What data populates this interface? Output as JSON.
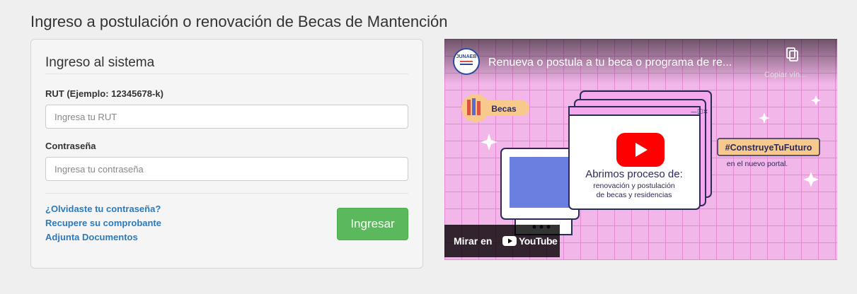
{
  "page": {
    "title": "Ingreso a postulación o renovación de Becas de Mantención"
  },
  "login": {
    "legend": "Ingreso al sistema",
    "rut_label": "RUT (Ejemplo: 12345678-k)",
    "rut_placeholder": "Ingresa tu RUT",
    "password_label": "Contraseña",
    "password_placeholder": "Ingresa tu contraseña",
    "links": [
      "¿Olvidaste tu contraseña?",
      "Recupere su comprobante",
      "Adjunta Documentos"
    ],
    "submit_label": "Ingresar"
  },
  "video": {
    "channel_logo": "JUNAEB",
    "title": "Renueva o postula a tu beca o programa de re...",
    "copy_label": "Copiar vín...",
    "badge": "Becas",
    "window_heading": "Abrimos proceso de:",
    "window_line1": "renovación y postulación",
    "window_line2": "de becas y residencias",
    "hashtag": "#ConstruyeTuFuturo",
    "subtext": "en el nuevo portal.",
    "watch_on": "Mirar en",
    "youtube": "YouTube",
    "colors": {
      "background": "#f3b6e8",
      "grid": "#e38ad6",
      "play": "#ff0000",
      "hashtag_bg": "#f7c98c"
    }
  }
}
